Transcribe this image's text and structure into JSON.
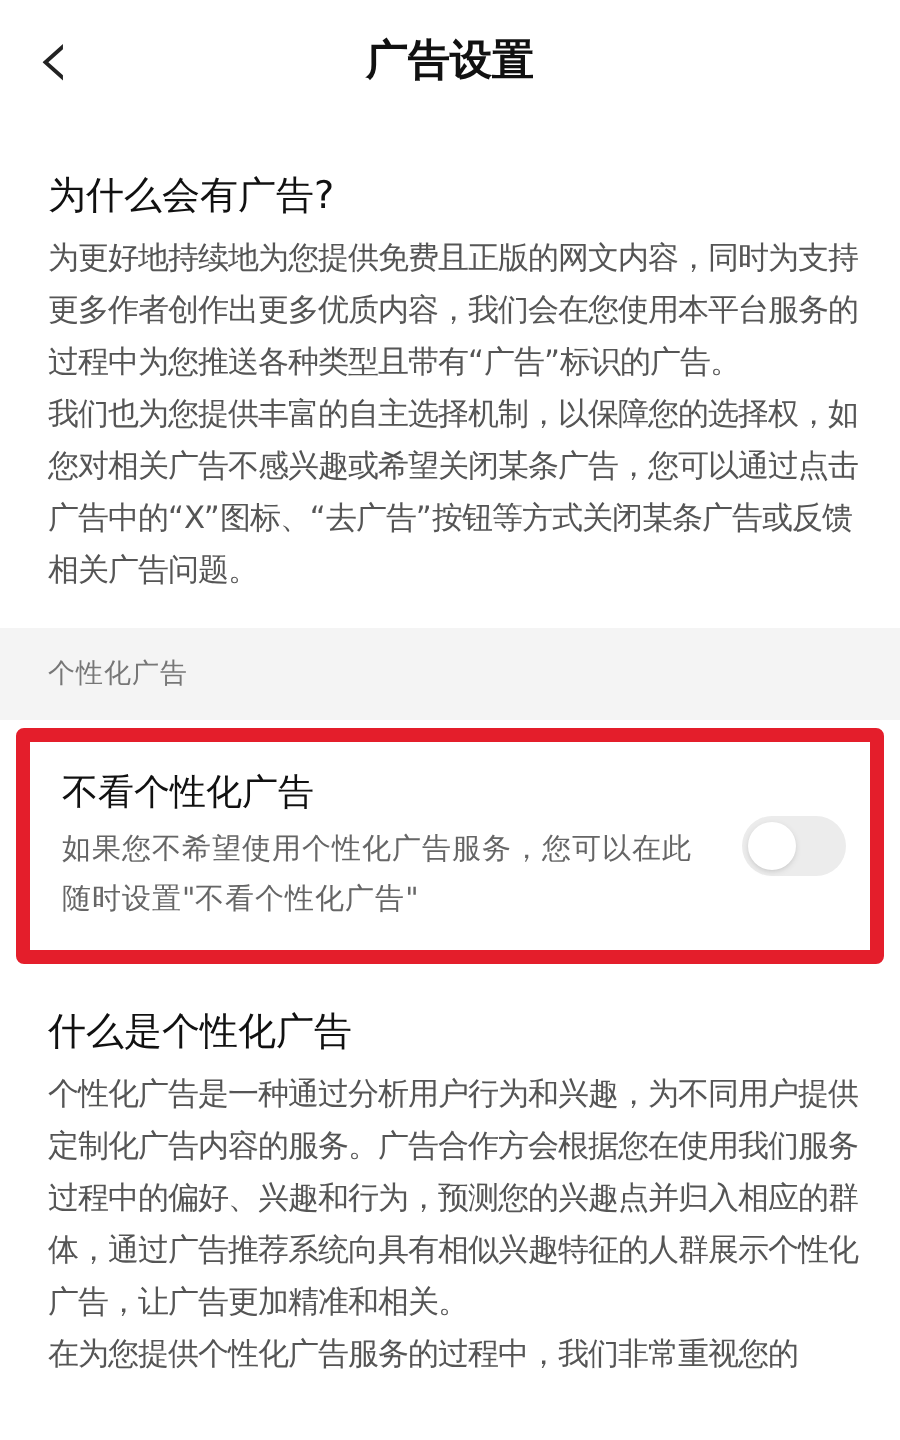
{
  "header": {
    "back_icon": "‹",
    "title": "广告设置"
  },
  "intro": {
    "heading": "为什么会有广告?",
    "paragraphs": [
      "为更好地持续地为您提供免费且正版的网文内容，同时为支持更多作者创作出更多优质内容，我们会在您使用本平台服务的过程中为您推送各种类型且带有“广告”标识的广告。",
      "我们也为您提供丰富的自主选择机制，以保障您的选择权，如您对相关广告不感兴趣或希望关闭某条广告，您可以通过点击广告中的“X”图标、“去广告”按钮等方式关闭某条广告或反馈相关广告问题。"
    ]
  },
  "section_label": "个性化广告",
  "setting": {
    "title": "不看个性化广告",
    "description": "如果您不希望使用个性化广告服务，您可以在此随时设置\"不看个性化广告\"",
    "on": false,
    "highlighted": true
  },
  "about": {
    "heading": "什么是个性化广告",
    "paragraphs": [
      "个性化广告是一种通过分析用户行为和兴趣，为不同用户提供定制化广告内容的服务。广告合作方会根据您在使用我们服务过程中的偏好、兴趣和行为，预测您的兴趣点并归入相应的群体，通过广告推荐系统向具有相似兴趣特征的人群展示个性化广告，让广告更加精准和相关。",
      "在为您提供个性化广告服务的过程中，我们非常重视您的"
    ]
  }
}
